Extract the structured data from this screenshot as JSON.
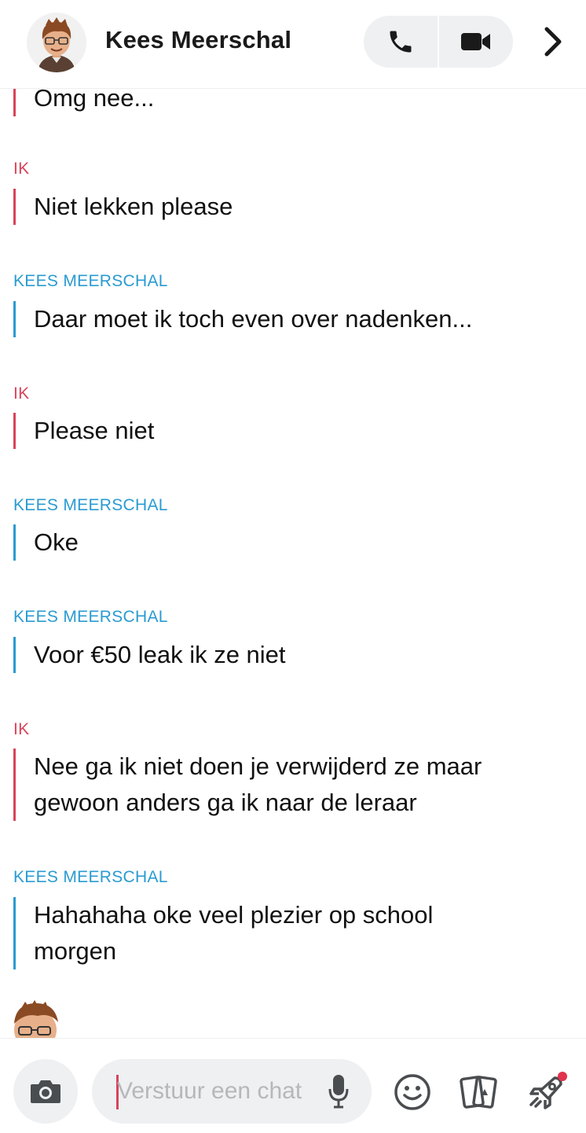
{
  "header": {
    "contact_name": "Kees Meerschal",
    "avatar_icon": "bitmoji-avatar",
    "call_icon": "phone-icon",
    "video_icon": "video-camera-icon",
    "more_icon": "chevron-right-icon"
  },
  "colors": {
    "me": "#d9435a",
    "them": "#2a9bd1",
    "pill_bg": "#eef0f2"
  },
  "messages": [
    {
      "sender": "",
      "text": "Omg nee...",
      "from": "them"
    },
    {
      "sender": "IK",
      "text": "Niet lekken please",
      "from": "me"
    },
    {
      "sender": "KEES MEERSCHAL",
      "text": "Daar moet ik toch even over nadenken...",
      "from": "them"
    },
    {
      "sender": "IK",
      "text": "Please niet",
      "from": "me"
    },
    {
      "sender": "KEES MEERSCHAL",
      "text": "Oke",
      "from": "them"
    },
    {
      "sender": "KEES MEERSCHAL",
      "text": "Voor €50 leak ik ze niet",
      "from": "them"
    },
    {
      "sender": "IK",
      "text": "Nee ga ik niet doen je verwijderd ze maar gewoon anders ga ik naar de leraar",
      "from": "me"
    },
    {
      "sender": "KEES MEERSCHAL",
      "text": "Hahahaha oke veel plezier op school morgen",
      "from": "them"
    }
  ],
  "composer": {
    "placeholder": "Verstuur een chat",
    "camera_icon": "camera-icon",
    "mic_icon": "microphone-icon",
    "emoji_icon": "smiley-icon",
    "sticker_icon": "cards-icon",
    "games_icon": "rocket-icon"
  }
}
